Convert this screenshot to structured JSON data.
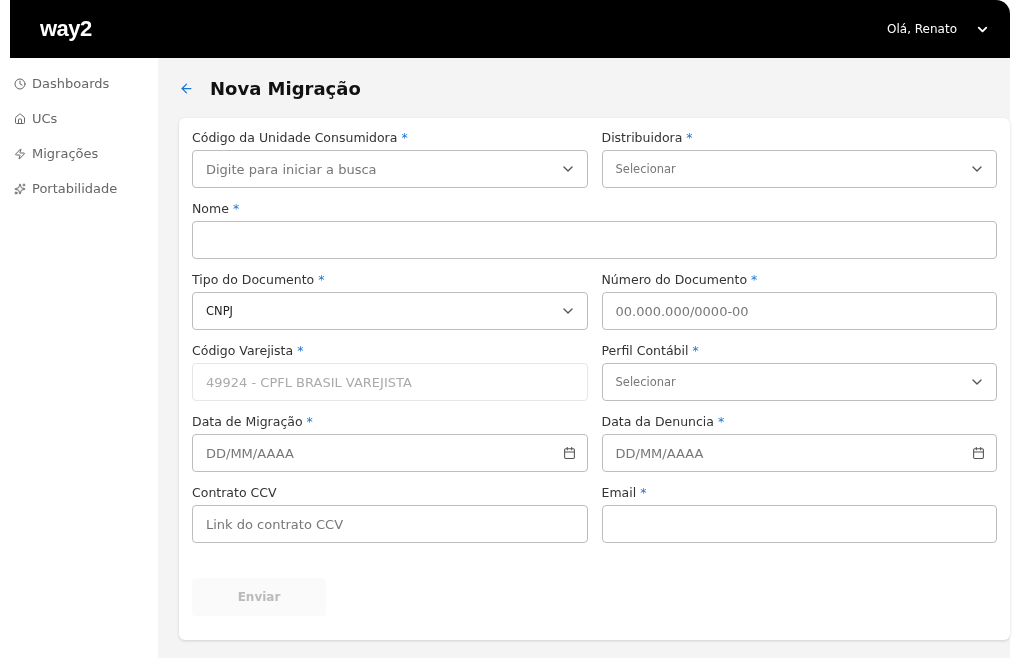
{
  "header": {
    "logo": "way2",
    "greeting": "Olá, Renato"
  },
  "sidebar": {
    "items": [
      {
        "label": "Dashboards",
        "selected": false
      },
      {
        "label": "UCs",
        "selected": false
      },
      {
        "label": "Migrações",
        "selected": false
      },
      {
        "label": "Portabilidade",
        "selected": false
      }
    ]
  },
  "page": {
    "title": "Nova Migração"
  },
  "form": {
    "rows": [
      [
        {
          "kind": "select",
          "label": "Código da Unidade Consumidora",
          "required_mark": "*",
          "placeholder": "Digite para iniciar a busca",
          "disabled": false
        },
        {
          "kind": "select",
          "label": "Distribuidora",
          "required_mark": "*",
          "placeholder": "Selecionar",
          "disabled": false
        }
      ],
      [
        {
          "kind": "text",
          "label": "Nome",
          "required_mark": "*",
          "disabled": false
        }
      ],
      [
        {
          "kind": "select",
          "label": "Tipo do Documento",
          "required_mark": "*",
          "value": "CNPJ",
          "disabled": false
        },
        {
          "kind": "text",
          "label": "Número do Documento",
          "required_mark": "*",
          "placeholder": "00.000.000/0000-00",
          "disabled": false
        }
      ],
      [
        {
          "kind": "text",
          "label": "Código Varejista",
          "required_mark": "*",
          "value": "49924 - CPFL BRASIL VAREJISTA",
          "disabled": true
        },
        {
          "kind": "select",
          "label": "Perfil Contábil",
          "required_mark": "*",
          "placeholder": "Selecionar",
          "disabled": false
        }
      ],
      [
        {
          "kind": "date",
          "label": "Data de Migração",
          "required_mark": "*",
          "placeholder": "DD/MM/AAAA",
          "disabled": false
        },
        {
          "kind": "date",
          "label": "Data da Denuncia",
          "required_mark": "*",
          "placeholder": "DD/MM/AAAA",
          "disabled": false
        }
      ],
      [
        {
          "kind": "text",
          "label": "Contrato CCV",
          "placeholder": "Link do contrato CCV",
          "disabled": false
        },
        {
          "kind": "text",
          "label": "Email",
          "required_mark": "*",
          "disabled": false
        }
      ]
    ],
    "submit": {
      "label": "Enviar",
      "disabled": true
    }
  }
}
